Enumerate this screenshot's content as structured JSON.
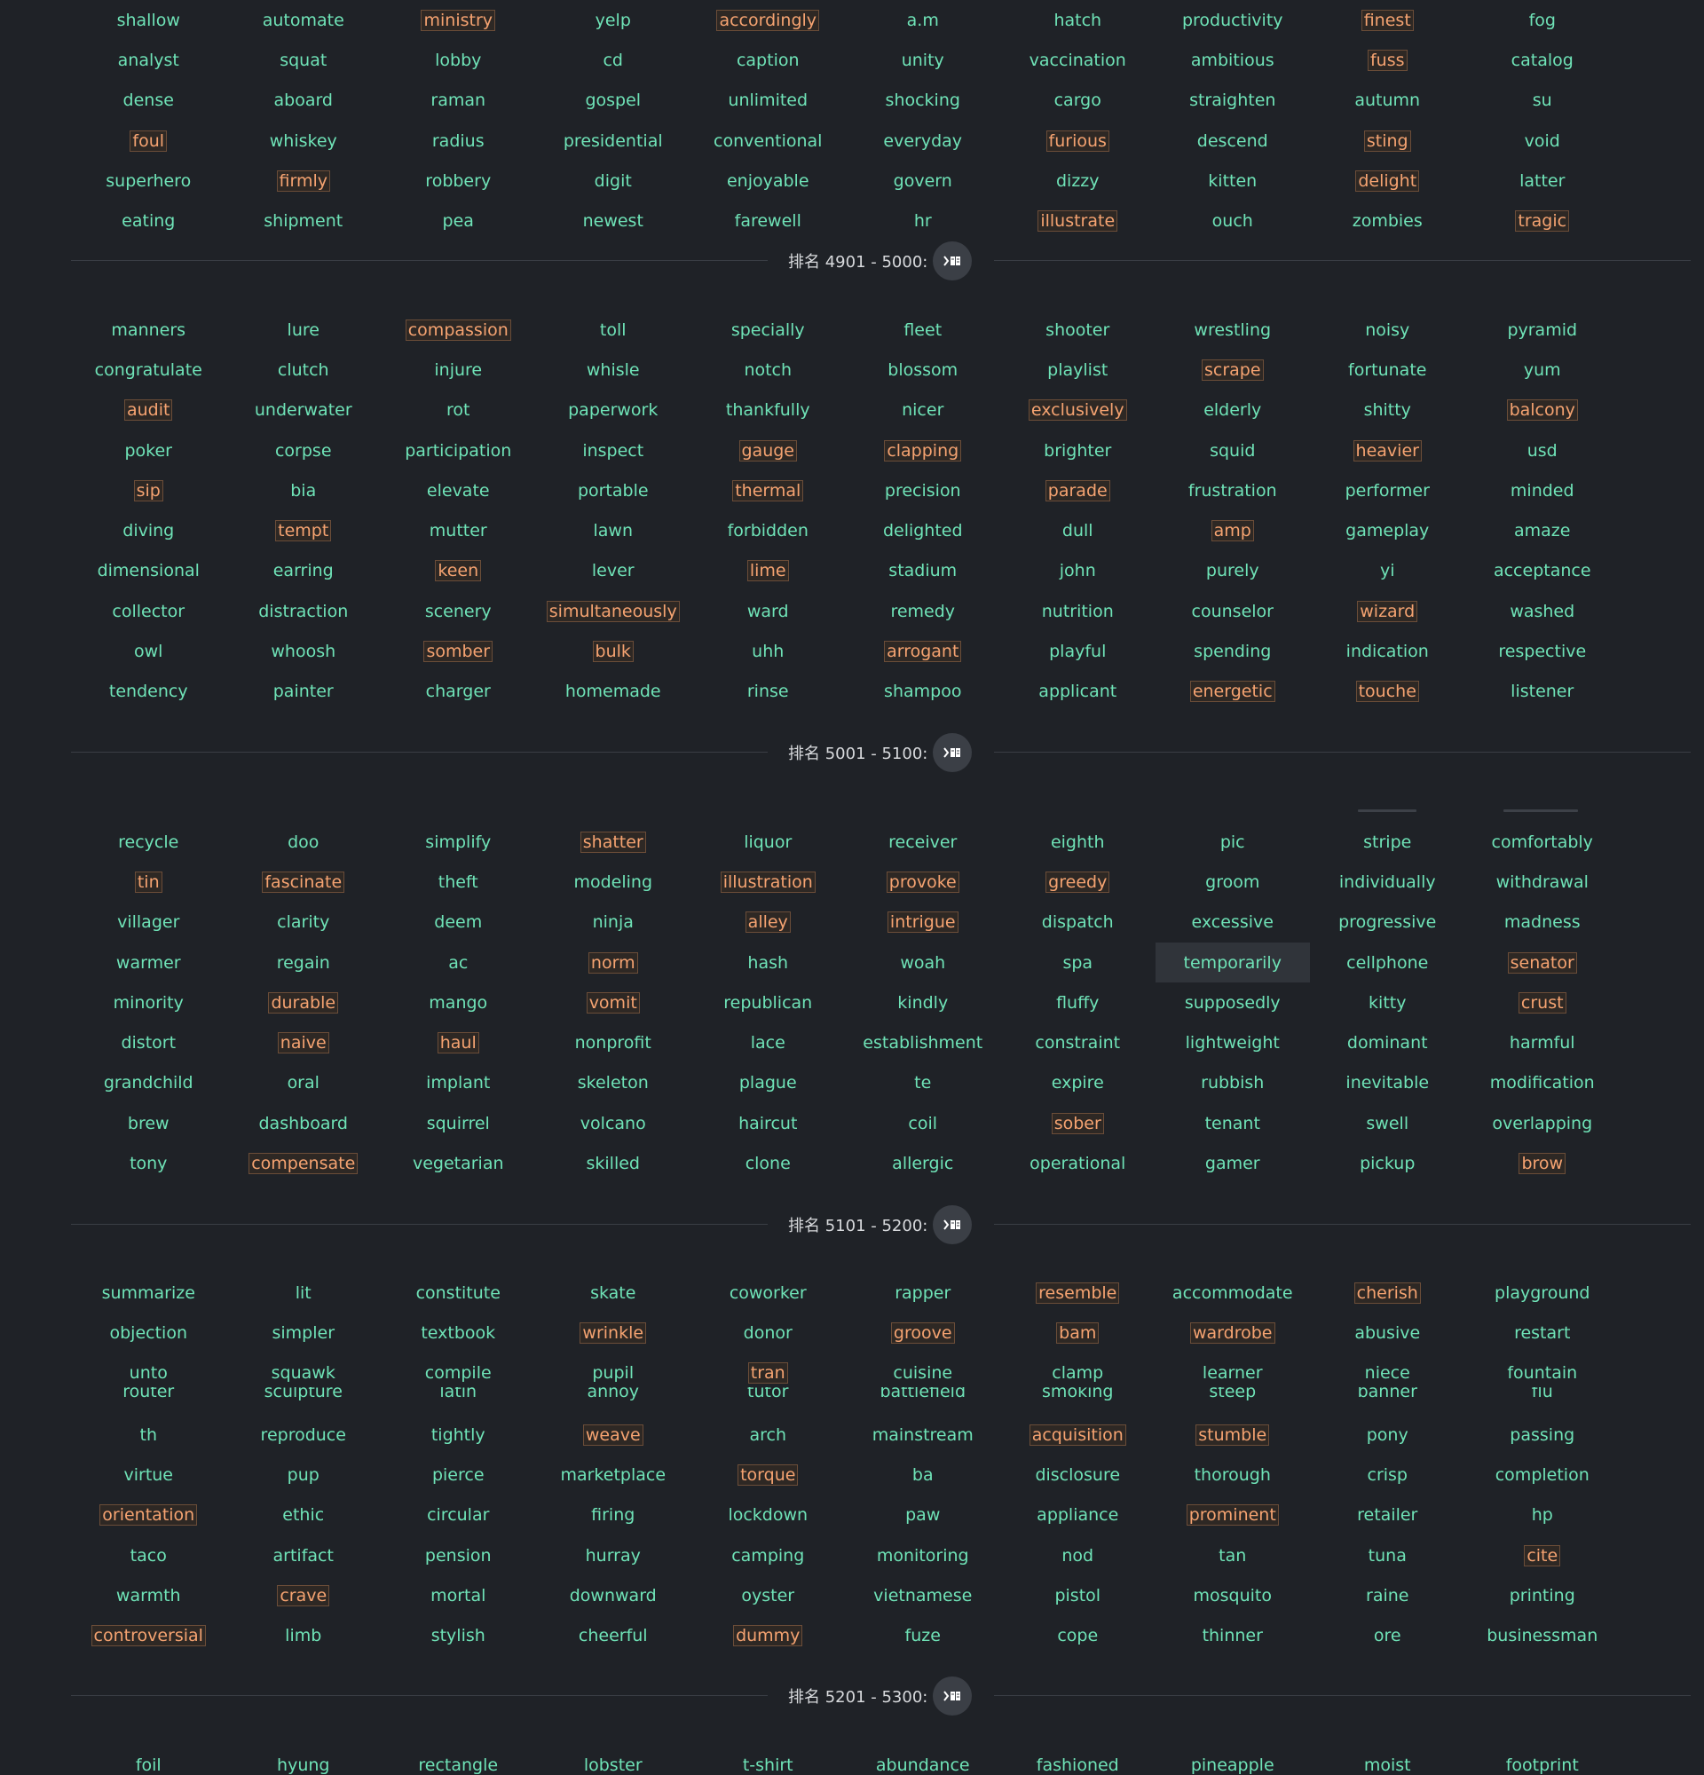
{
  "icons": {
    "section_button_icon": "reader-play-icon"
  },
  "colors": {
    "background": "#1f2227",
    "word": "#6fe3b7",
    "highlight_text": "#f5a371",
    "highlight_border": "#6b4d38",
    "divider_label": "#d8dadd"
  },
  "top_grid": {
    "words": [
      "shallow",
      "automate",
      "ministry",
      "yelp",
      "accordingly",
      "a.m",
      "hatch",
      "productivity",
      "finest",
      "fog",
      "analyst",
      "squat",
      "lobby",
      "cd",
      "caption",
      "unity",
      "vaccination",
      "ambitious",
      "fuss",
      "catalog",
      "dense",
      "aboard",
      "raman",
      "gospel",
      "unlimited",
      "shocking",
      "cargo",
      "straighten",
      "autumn",
      "su",
      "foul",
      "whiskey",
      "radius",
      "presidential",
      "conventional",
      "everyday",
      "furious",
      "descend",
      "sting",
      "void",
      "superhero",
      "firmly",
      "robbery",
      "digit",
      "enjoyable",
      "govern",
      "dizzy",
      "kitten",
      "delight",
      "latter",
      "eating",
      "shipment",
      "pea",
      "newest",
      "farewell",
      "hr",
      "illustrate",
      "ouch",
      "zombies",
      "tragic"
    ],
    "highlighted": [
      "ministry",
      "accordingly",
      "finest",
      "fuss",
      "foul",
      "furious",
      "sting",
      "firmly",
      "delight",
      "illustrate",
      "tragic"
    ]
  },
  "sections": [
    {
      "label": "排名 4901 - 5000:",
      "words": [
        "manners",
        "lure",
        "compassion",
        "toll",
        "specially",
        "fleet",
        "shooter",
        "wrestling",
        "noisy",
        "pyramid",
        "congratulate",
        "clutch",
        "injure",
        "whisle",
        "notch",
        "blossom",
        "playlist",
        "scrape",
        "fortunate",
        "yum",
        "audit",
        "underwater",
        "rot",
        "paperwork",
        "thankfully",
        "nicer",
        "exclusively",
        "elderly",
        "shitty",
        "balcony",
        "poker",
        "corpse",
        "participation",
        "inspect",
        "gauge",
        "clapping",
        "brighter",
        "squid",
        "heavier",
        "usd",
        "sip",
        "bia",
        "elevate",
        "portable",
        "thermal",
        "precision",
        "parade",
        "frustration",
        "performer",
        "minded",
        "diving",
        "tempt",
        "mutter",
        "lawn",
        "forbidden",
        "delighted",
        "dull",
        "amp",
        "gameplay",
        "amaze",
        "dimensional",
        "earring",
        "keen",
        "lever",
        "lime",
        "stadium",
        "john",
        "purely",
        "yi",
        "acceptance",
        "collector",
        "distraction",
        "scenery",
        "simultaneously",
        "ward",
        "remedy",
        "nutrition",
        "counselor",
        "wizard",
        "washed",
        "owl",
        "whoosh",
        "somber",
        "bulk",
        "uhh",
        "arrogant",
        "playful",
        "spending",
        "indication",
        "respective",
        "tendency",
        "painter",
        "charger",
        "homemade",
        "rinse",
        "shampoo",
        "applicant",
        "energetic",
        "touche",
        "listener"
      ],
      "highlighted": [
        "compassion",
        "scrape",
        "audit",
        "exclusively",
        "balcony",
        "gauge",
        "clapping",
        "heavier",
        "sip",
        "thermal",
        "parade",
        "tempt",
        "amp",
        "keen",
        "lime",
        "simultaneously",
        "wizard",
        "somber",
        "bulk",
        "arrogant",
        "energetic",
        "touche"
      ]
    },
    {
      "label": "排名 5001 - 5100:",
      "words": [
        "recycle",
        "doo",
        "simplify",
        "shatter",
        "liquor",
        "receiver",
        "eighth",
        "pic",
        "stripe",
        "comfortably",
        "tin",
        "fascinate",
        "theft",
        "modeling",
        "illustration",
        "provoke",
        "greedy",
        "groom",
        "individually",
        "withdrawal",
        "villager",
        "clarity",
        "deem",
        "ninja",
        "alley",
        "intrigue",
        "dispatch",
        "excessive",
        "progressive",
        "madness",
        "warmer",
        "regain",
        "ac",
        "norm",
        "hash",
        "woah",
        "spa",
        "temporarily",
        "cellphone",
        "senator",
        "minority",
        "durable",
        "mango",
        "vomit",
        "republican",
        "kindly",
        "fluffy",
        "supposedly",
        "kitty",
        "crust",
        "distort",
        "naive",
        "haul",
        "nonprofit",
        "lace",
        "establishment",
        "constraint",
        "lightweight",
        "dominant",
        "harmful",
        "grandchild",
        "oral",
        "implant",
        "skeleton",
        "plague",
        "te",
        "expire",
        "rubbish",
        "inevitable",
        "modification",
        "brew",
        "dashboard",
        "squirrel",
        "volcano",
        "haircut",
        "coil",
        "sober",
        "tenant",
        "swell",
        "overlapping",
        "tony",
        "compensate",
        "vegetarian",
        "skilled",
        "clone",
        "allergic",
        "operational",
        "gamer",
        "pickup",
        "brow"
      ],
      "highlighted": [
        "shatter",
        "tin",
        "fascinate",
        "illustration",
        "provoke",
        "greedy",
        "alley",
        "intrigue",
        "norm",
        "senator",
        "durable",
        "vomit",
        "crust",
        "naive",
        "haul",
        "sober",
        "compensate",
        "brow"
      ],
      "selected": "temporarily"
    },
    {
      "label": "排名 5101 - 5200:",
      "words_top": [
        "summarize",
        "lit",
        "constitute",
        "skate",
        "coworker",
        "rapper",
        "resemble",
        "accommodate",
        "cherish",
        "playground",
        "objection",
        "simpler",
        "textbook",
        "wrinkle",
        "donor",
        "groove",
        "bam",
        "wardrobe",
        "abusive",
        "restart",
        "unto",
        "squawk",
        "compile",
        "pupil",
        "tran",
        "cuisine",
        "clamp",
        "learner",
        "niece",
        "fountain"
      ],
      "words_cut": [
        "router",
        "sculpture",
        "latin",
        "annoy",
        "tutor",
        "battlefield",
        "smoking",
        "steep",
        "banner",
        "flu"
      ],
      "words_bottom": [
        "th",
        "reproduce",
        "tightly",
        "weave",
        "arch",
        "mainstream",
        "acquisition",
        "stumble",
        "pony",
        "passing",
        "virtue",
        "pup",
        "pierce",
        "marketplace",
        "torque",
        "ba",
        "disclosure",
        "thorough",
        "crisp",
        "completion",
        "orientation",
        "ethic",
        "circular",
        "firing",
        "lockdown",
        "paw",
        "appliance",
        "prominent",
        "retailer",
        "hp",
        "taco",
        "artifact",
        "pension",
        "hurray",
        "camping",
        "monitoring",
        "nod",
        "tan",
        "tuna",
        "cite",
        "warmth",
        "crave",
        "mortal",
        "downward",
        "oyster",
        "vietnamese",
        "pistol",
        "mosquito",
        "raine",
        "printing",
        "controversial",
        "limb",
        "stylish",
        "cheerful",
        "dummy",
        "fuze",
        "cope",
        "thinner",
        "ore",
        "businessman"
      ],
      "highlighted": [
        "resemble",
        "cherish",
        "wrinkle",
        "groove",
        "bam",
        "wardrobe",
        "tran",
        "weave",
        "acquisition",
        "stumble",
        "torque",
        "orientation",
        "prominent",
        "cite",
        "crave",
        "controversial",
        "dummy"
      ]
    },
    {
      "label": "排名 5201 - 5300:",
      "words": [
        "foil",
        "hyung",
        "rectangle",
        "lobster",
        "t-shirt",
        "abundance",
        "fashioned",
        "pineapple",
        "moist",
        "footprint"
      ],
      "highlighted": []
    }
  ]
}
